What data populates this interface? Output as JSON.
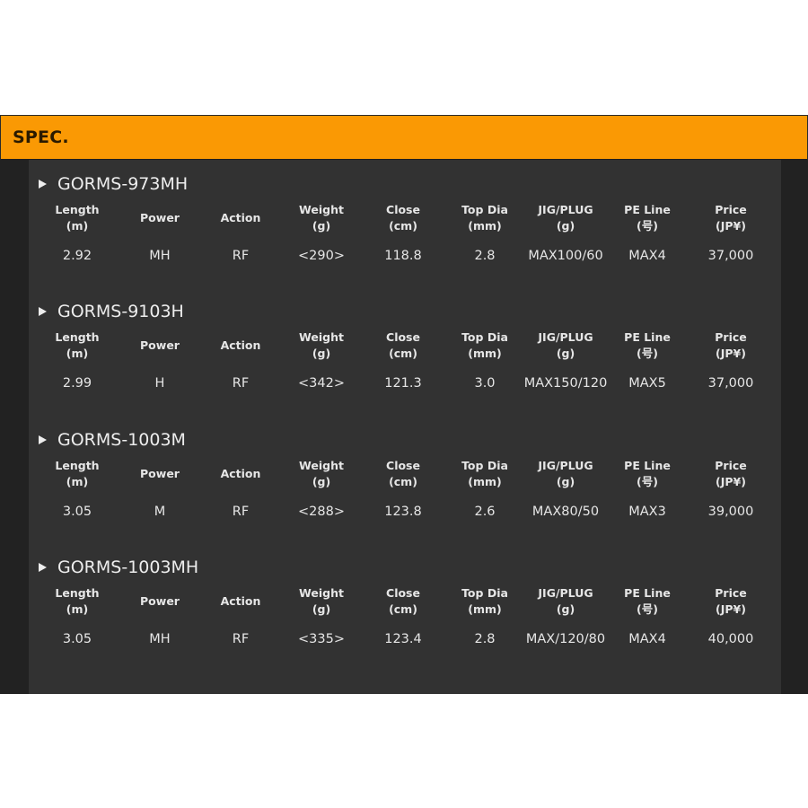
{
  "header": {
    "title": "SPEC."
  },
  "columns": [
    {
      "line1": "Length",
      "line2": "(m)"
    },
    {
      "line1": "Power",
      "line2": ""
    },
    {
      "line1": "Action",
      "line2": ""
    },
    {
      "line1": "Weight",
      "line2": "(g)"
    },
    {
      "line1": "Close",
      "line2": "(cm)"
    },
    {
      "line1": "Top Dia",
      "line2": "(mm)"
    },
    {
      "line1": "JIG/PLUG",
      "line2": "(g)"
    },
    {
      "line1": "PE Line",
      "line2": "(号)"
    },
    {
      "line1": "Price",
      "line2": "(JP¥)"
    }
  ],
  "models": [
    {
      "name": "GORMS-973MH",
      "values": [
        "2.92",
        "MH",
        "RF",
        "<290>",
        "118.8",
        "2.8",
        "MAX100/60",
        "MAX4",
        "37,000"
      ]
    },
    {
      "name": "GORMS-9103H",
      "values": [
        "2.99",
        "H",
        "RF",
        "<342>",
        "121.3",
        "3.0",
        "MAX150/120",
        "MAX5",
        "37,000"
      ]
    },
    {
      "name": "GORMS-1003M",
      "values": [
        "3.05",
        "M",
        "RF",
        "<288>",
        "123.8",
        "2.6",
        "MAX80/50",
        "MAX3",
        "39,000"
      ]
    },
    {
      "name": "GORMS-1003MH",
      "values": [
        "3.05",
        "MH",
        "RF",
        "<335>",
        "123.4",
        "2.8",
        "MAX/120/80",
        "MAX4",
        "40,000"
      ]
    }
  ]
}
